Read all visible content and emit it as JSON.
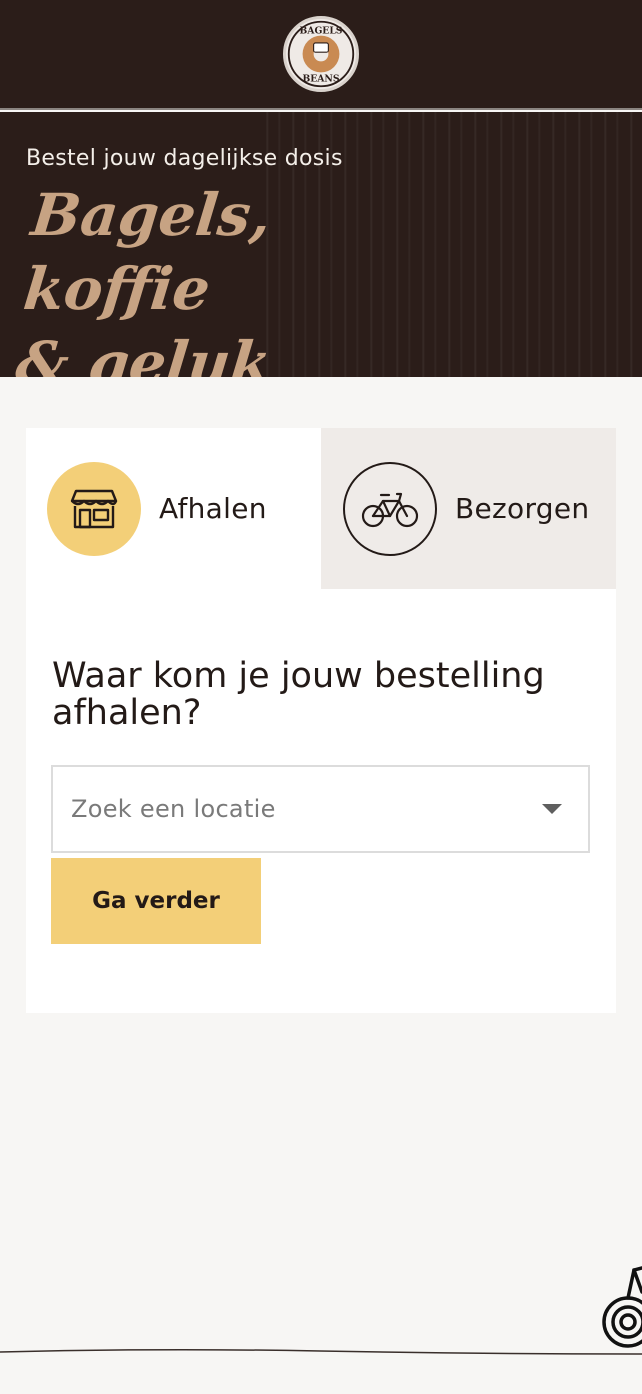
{
  "header": {
    "logo_icon": "bagels-beans-logo",
    "logo_text_top": "BAGELS",
    "logo_text_bottom": "BEANS"
  },
  "hero": {
    "subtitle": "Bestel jouw dagelijkse dosis",
    "title_line1": "Bagels, koffie",
    "title_line2": "& geluk"
  },
  "order": {
    "tabs": [
      {
        "label": "Afhalen",
        "icon": "storefront-icon",
        "active": true
      },
      {
        "label": "Bezorgen",
        "icon": "bicycle-icon",
        "active": false
      }
    ],
    "question": "Waar kom je jouw bestelling afhalen?",
    "location_select": {
      "placeholder": "Zoek een locatie",
      "icon": "chevron-down-icon"
    },
    "continue_label": "Ga verder"
  },
  "colors": {
    "header_bg": "#2b1d19",
    "accent_yellow": "#f3cf78",
    "hero_title": "#c7a383",
    "page_bg": "#f7f6f4",
    "inactive_tab_bg": "#efebe8"
  }
}
